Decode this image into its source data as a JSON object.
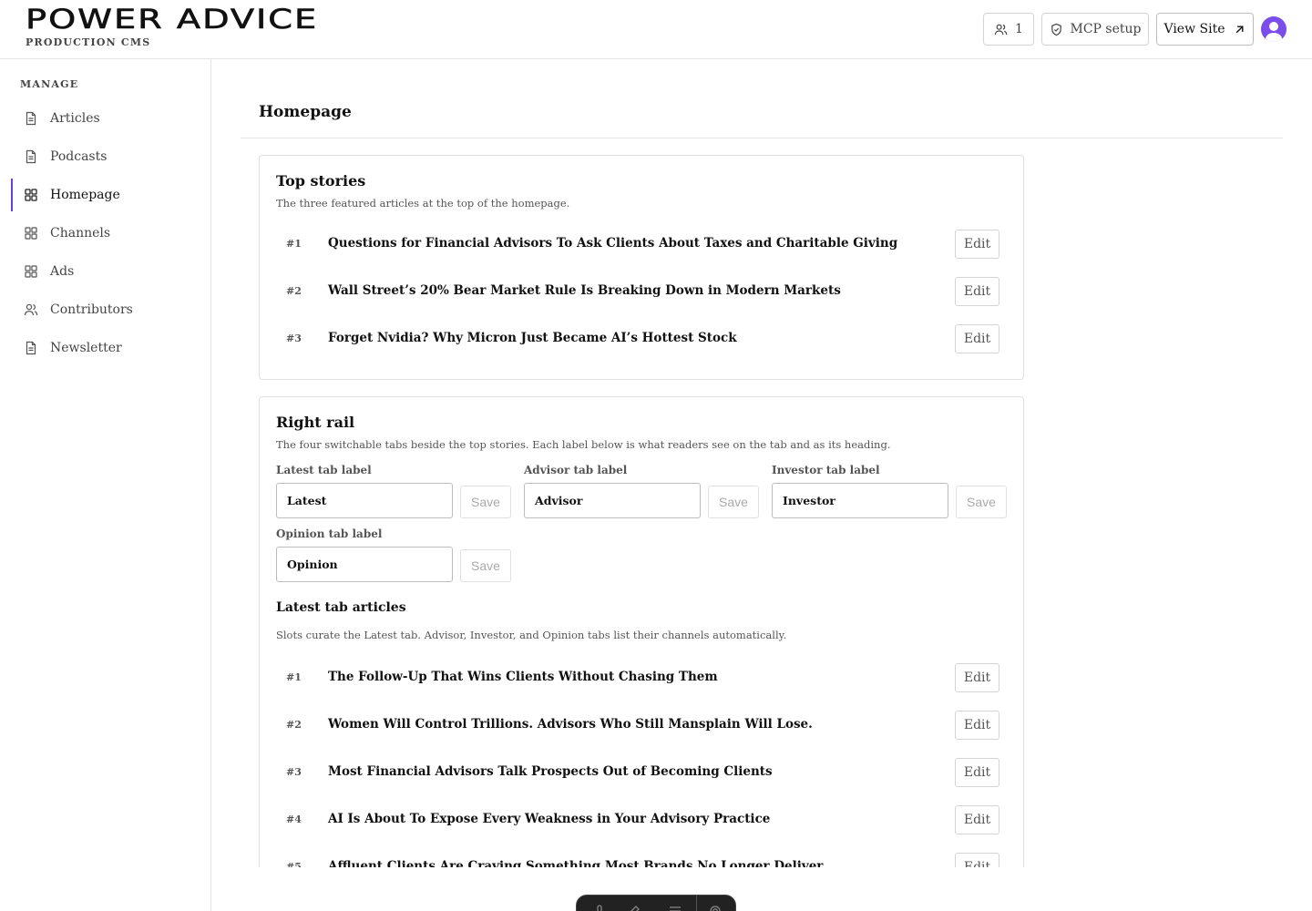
{
  "brand": {
    "logo": "POWER ADVICE",
    "subtitle": "PRODUCTION CMS"
  },
  "header": {
    "users_count": "1",
    "mcp_label": "MCP setup",
    "view_site_label": "View Site"
  },
  "sidebar": {
    "section_label": "MANAGE",
    "items": [
      {
        "label": "Articles",
        "icon": "document-icon"
      },
      {
        "label": "Podcasts",
        "icon": "document-icon"
      },
      {
        "label": "Homepage",
        "icon": "grid-icon",
        "active": true
      },
      {
        "label": "Channels",
        "icon": "grid-icon"
      },
      {
        "label": "Ads",
        "icon": "grid-icon"
      },
      {
        "label": "Contributors",
        "icon": "users-icon"
      },
      {
        "label": "Newsletter",
        "icon": "document-icon"
      }
    ]
  },
  "page": {
    "title": "Homepage"
  },
  "top_stories": {
    "title": "Top stories",
    "description": "The three featured articles at the top of the homepage.",
    "edit_label": "Edit",
    "items": [
      {
        "num": "#1",
        "title": "Questions for Financial Advisors To Ask Clients About Taxes and Charitable Giving"
      },
      {
        "num": "#2",
        "title": "Wall Street’s 20% Bear Market Rule Is Breaking Down in Modern Markets"
      },
      {
        "num": "#3",
        "title": "Forget Nvidia? Why Micron Just Became AI’s Hottest Stock"
      }
    ]
  },
  "right_rail": {
    "title": "Right rail",
    "description": "The four switchable tabs beside the top stories. Each label below is what readers see on the tab and as its heading.",
    "save_label": "Save",
    "fields": [
      {
        "label": "Latest tab label",
        "value": "Latest"
      },
      {
        "label": "Advisor tab label",
        "value": "Advisor"
      },
      {
        "label": "Investor tab label",
        "value": "Investor"
      },
      {
        "label": "Opinion tab label",
        "value": "Opinion"
      }
    ],
    "latest_title": "Latest tab articles",
    "latest_description": "Slots curate the Latest tab. Advisor, Investor, and Opinion tabs list their channels automatically.",
    "edit_label": "Edit",
    "latest_items": [
      {
        "num": "#1",
        "title": "The Follow-Up That Wins Clients Without Chasing Them"
      },
      {
        "num": "#2",
        "title": "Women Will Control Trillions. Advisors Who Still Mansplain Will Lose."
      },
      {
        "num": "#3",
        "title": "Most Financial Advisors Talk Prospects Out of Becoming Clients"
      },
      {
        "num": "#4",
        "title": "AI Is About To Expose Every Weakness in Your Advisory Practice"
      },
      {
        "num": "#5",
        "title": "Affluent Clients Are Craving Something Most Brands No Longer Deliver"
      }
    ]
  },
  "colors": {
    "accent": "#6b3fe0",
    "avatar": "#7b4dea",
    "border": "#e0e0e0"
  }
}
